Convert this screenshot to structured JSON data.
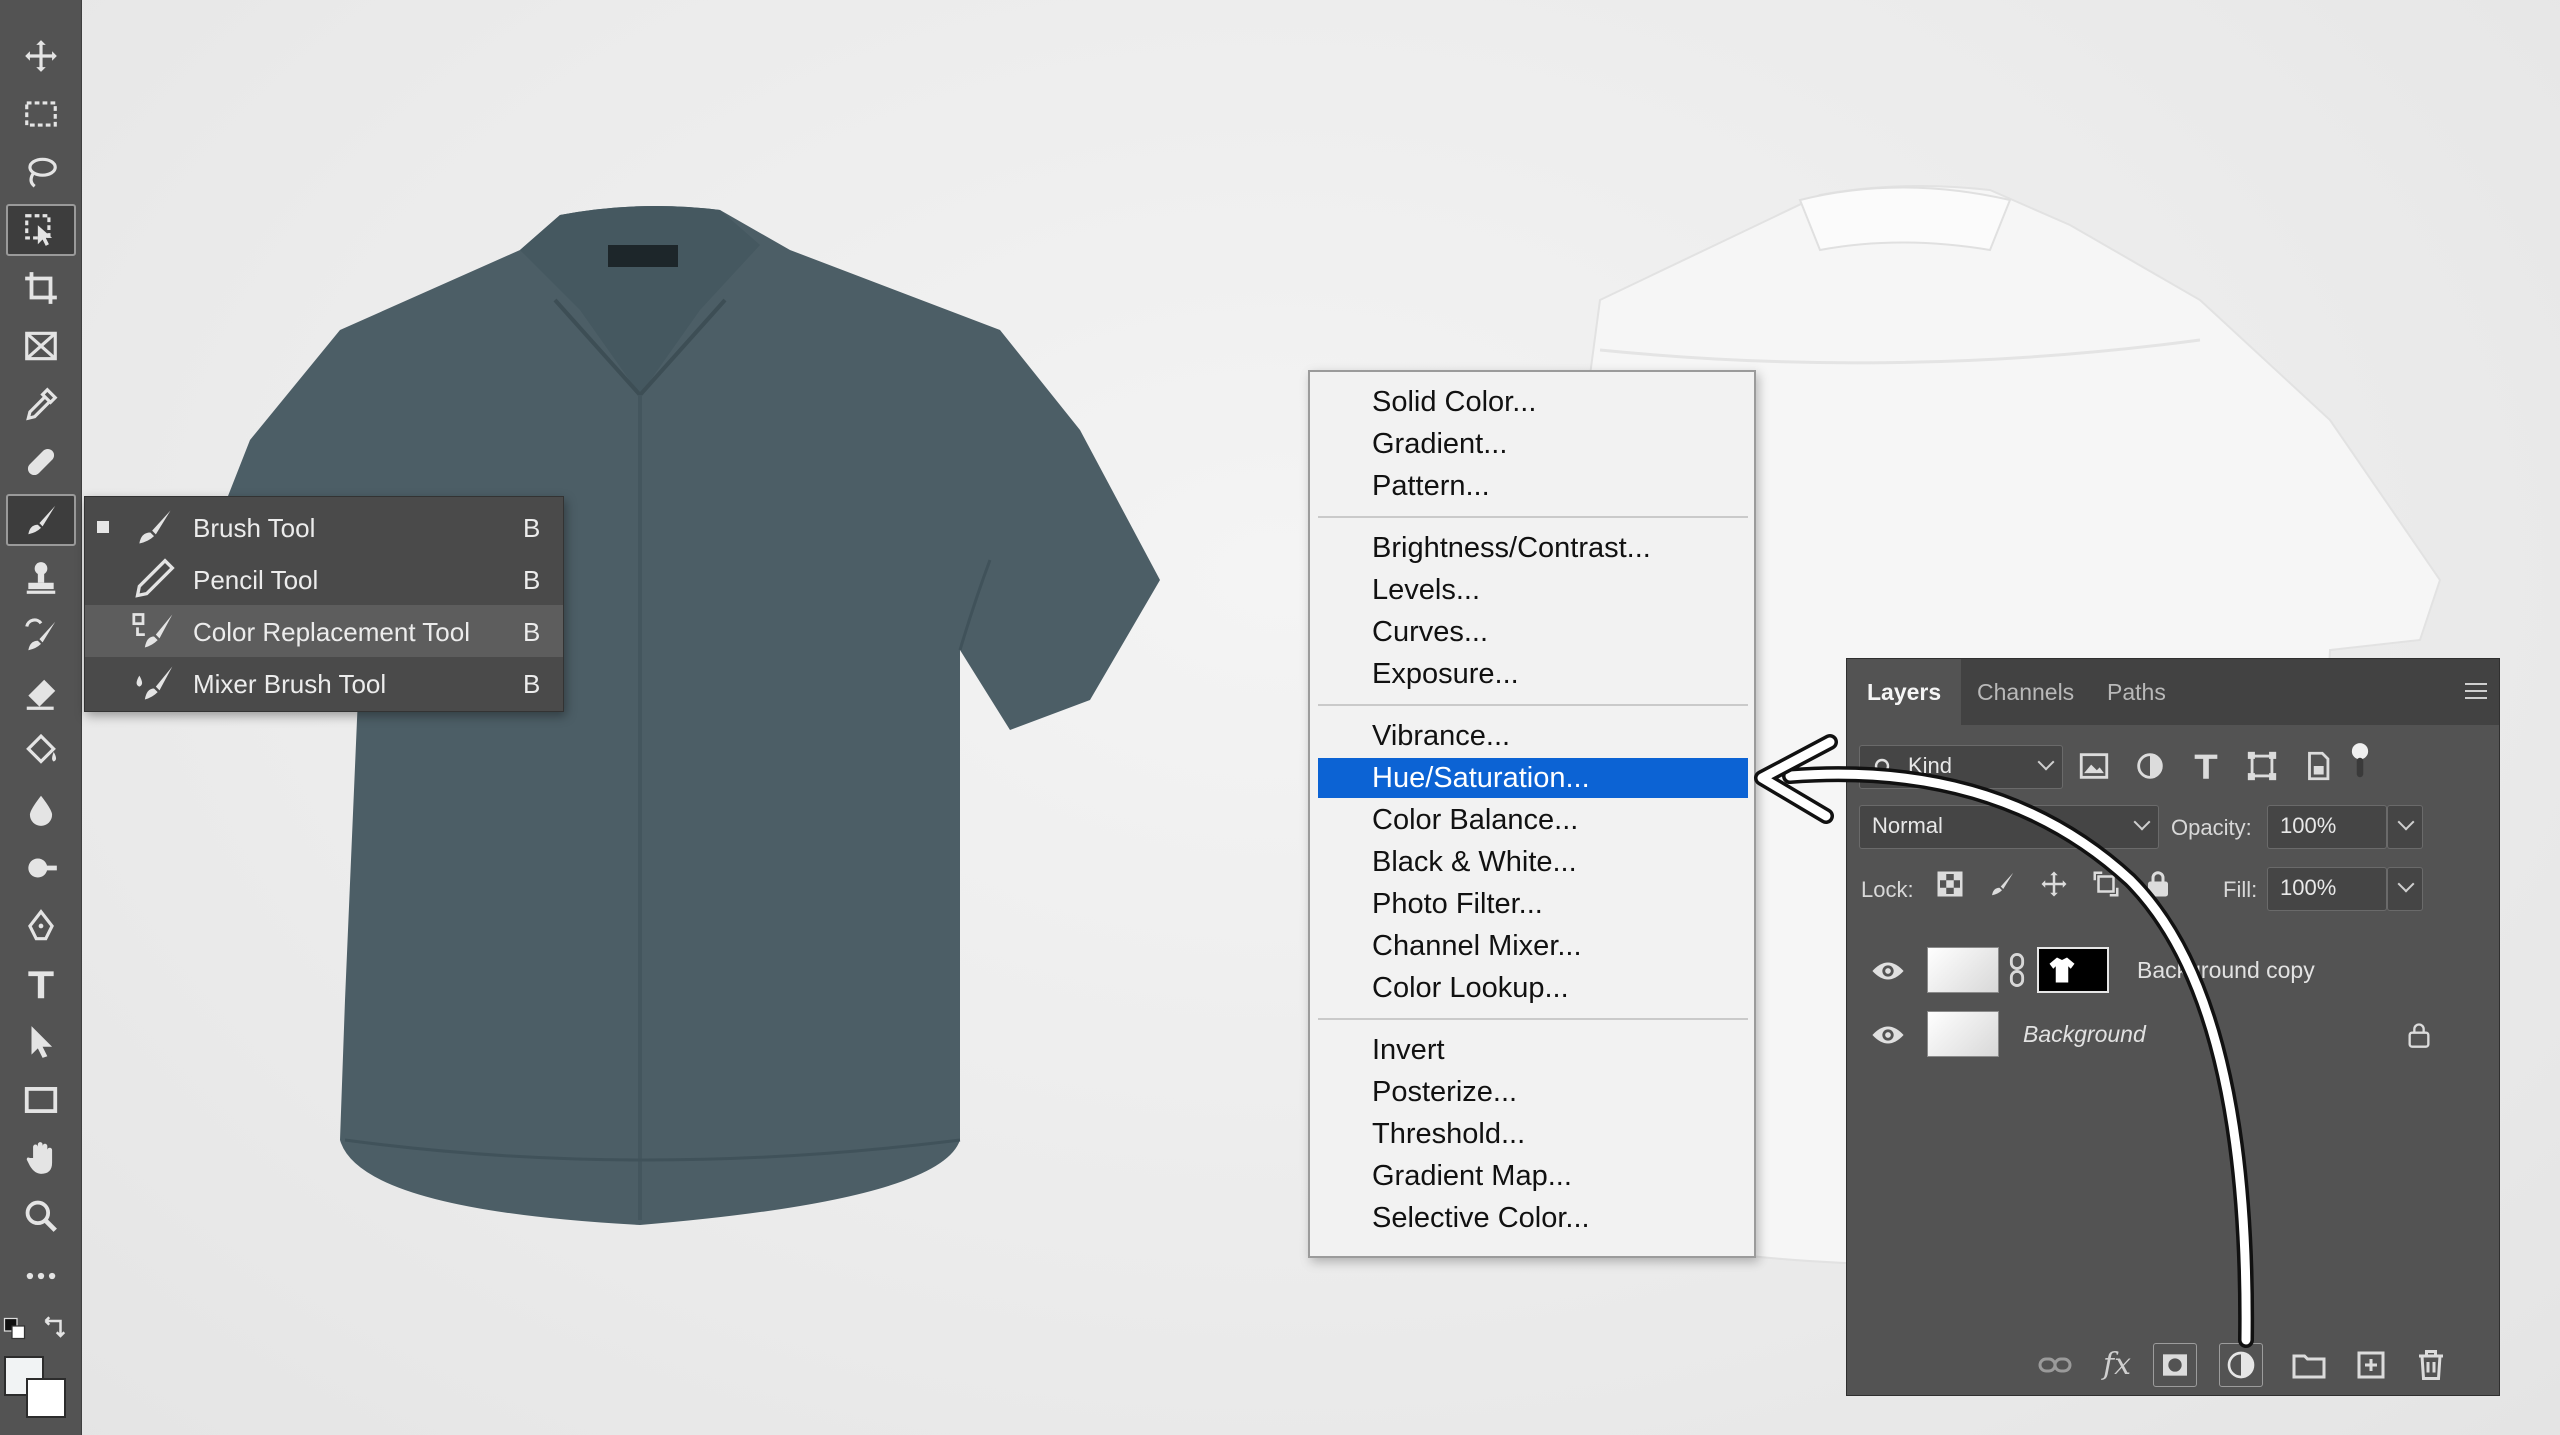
{
  "tools": [
    {
      "name": "move-tool",
      "icon": "move-icon"
    },
    {
      "name": "marquee-tool",
      "icon": "marquee-icon"
    },
    {
      "name": "lasso-tool",
      "icon": "lasso-icon"
    },
    {
      "name": "object-selection-tool",
      "icon": "object-selection-icon"
    },
    {
      "name": "crop-tool",
      "icon": "crop-icon"
    },
    {
      "name": "frame-tool",
      "icon": "frame-icon"
    },
    {
      "name": "eyedropper-tool",
      "icon": "eyedropper-icon"
    },
    {
      "name": "healing-tool",
      "icon": "bandage-icon"
    },
    {
      "name": "brush-tool",
      "icon": "brush-icon"
    },
    {
      "name": "stamp-tool",
      "icon": "stamp-icon"
    },
    {
      "name": "history-brush-tool",
      "icon": "history-brush-icon"
    },
    {
      "name": "eraser-tool",
      "icon": "eraser-icon"
    },
    {
      "name": "paint-bucket-tool",
      "icon": "bucket-icon"
    },
    {
      "name": "blur-tool",
      "icon": "drop-icon"
    },
    {
      "name": "dodge-tool",
      "icon": "dodge-icon"
    },
    {
      "name": "pen-tool",
      "icon": "pen-icon"
    },
    {
      "name": "type-tool",
      "icon": "type-icon"
    },
    {
      "name": "path-selection-tool",
      "icon": "arrow-icon"
    },
    {
      "name": "rectangle-tool",
      "icon": "rectangle-icon"
    },
    {
      "name": "hand-tool",
      "icon": "hand-icon"
    },
    {
      "name": "zoom-tool",
      "icon": "zoom-icon"
    },
    {
      "name": "more-tools",
      "icon": "ellipsis-icon"
    }
  ],
  "brush_flyout": [
    {
      "label": "Brush Tool",
      "key": "B"
    },
    {
      "label": "Pencil Tool",
      "key": "B"
    },
    {
      "label": "Color Replacement Tool",
      "key": "B"
    },
    {
      "label": "Mixer Brush Tool",
      "key": "B"
    }
  ],
  "adjustment_menu": {
    "groups": [
      [
        "Solid Color...",
        "Gradient...",
        "Pattern..."
      ],
      [
        "Brightness/Contrast...",
        "Levels...",
        "Curves...",
        "Exposure..."
      ],
      [
        "Vibrance...",
        "Hue/Saturation...",
        "Color Balance...",
        "Black & White...",
        "Photo Filter...",
        "Channel Mixer...",
        "Color Lookup..."
      ],
      [
        "Invert",
        "Posterize...",
        "Threshold...",
        "Gradient Map...",
        "Selective Color..."
      ]
    ],
    "selected": "Hue/Saturation..."
  },
  "layers_panel": {
    "tabs": [
      "Layers",
      "Channels",
      "Paths"
    ],
    "active_tab": "Layers",
    "filter_kind": "Kind",
    "blend_mode": "Normal",
    "opacity_label": "Opacity:",
    "opacity": "100%",
    "lock_label": "Lock:",
    "fill_label": "Fill:",
    "fill": "100%",
    "layers": [
      {
        "name": "Background copy",
        "italic": false,
        "has_mask": true,
        "locked": false
      },
      {
        "name": "Background",
        "italic": true,
        "has_mask": false,
        "locked": true
      }
    ]
  },
  "colors": {
    "shirt": "#4c5e66",
    "selection_blue": "#0c63d4",
    "panel_bg": "#535353"
  }
}
